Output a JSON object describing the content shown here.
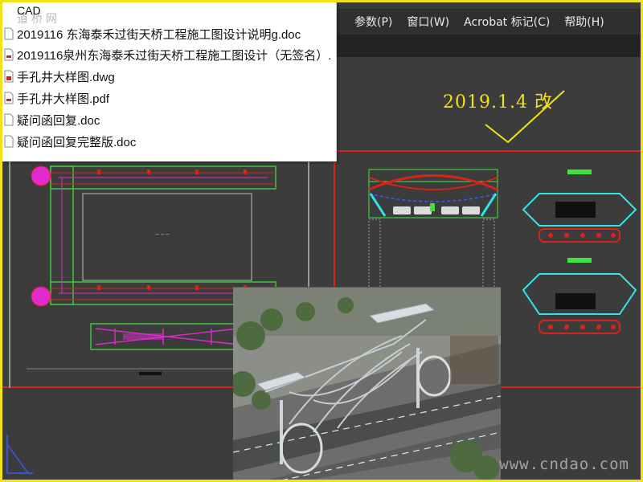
{
  "menubar": {
    "items": [
      "参数(P)",
      "窗口(W)",
      "Acrobat 标记(C)",
      "帮助(H)"
    ]
  },
  "filelist": {
    "header": "CAD",
    "watermark": "道桥网",
    "files": [
      {
        "name": "2019116 东海泰禾过街天桥工程施工图设计说明g.doc",
        "type": "doc"
      },
      {
        "name": "2019116泉州东海泰禾过街天桥工程施工图设计（无签名）.",
        "type": "pdf"
      },
      {
        "name": "手孔井大样图.dwg",
        "type": "dwg"
      },
      {
        "name": "手孔井大样图.pdf",
        "type": "pdf"
      },
      {
        "name": "疑问函回复.doc",
        "type": "doc"
      },
      {
        "name": "疑问函回复完整版.doc",
        "type": "doc"
      }
    ]
  },
  "annotation": {
    "revision_note": "2019.1.4 改"
  },
  "watermark": {
    "site": "www.cndao.com"
  },
  "colors": {
    "frame_border": "#f2e21a",
    "cad_red": "#d8221a",
    "cad_green": "#3fe23f",
    "cad_magenta": "#e22ad0",
    "cad_cyan": "#34e4e4"
  }
}
